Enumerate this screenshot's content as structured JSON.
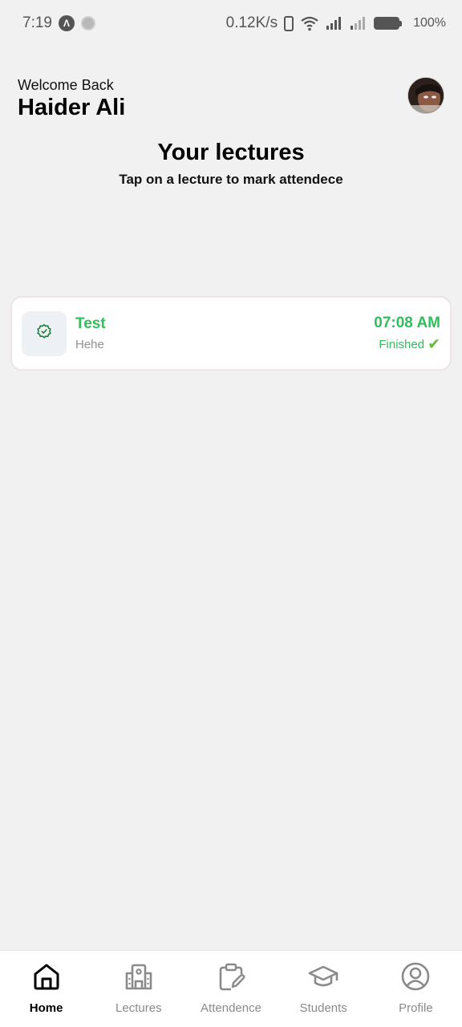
{
  "status_bar": {
    "time": "7:19",
    "network_speed": "0.12K/s",
    "battery": "100%"
  },
  "header": {
    "welcome": "Welcome Back",
    "user_name": "Haider Ali"
  },
  "section": {
    "title": "Your lectures",
    "subtitle": "Tap on a lecture to mark attendece"
  },
  "lectures": [
    {
      "title": "Test",
      "description": "Hehe",
      "time": "07:08 AM",
      "status": "Finished",
      "icon": "badge-check-icon"
    }
  ],
  "nav": {
    "items": [
      {
        "label": "Home",
        "icon": "home-icon",
        "active": true
      },
      {
        "label": "Lectures",
        "icon": "building-icon",
        "active": false
      },
      {
        "label": "Attendence",
        "icon": "clipboard-edit-icon",
        "active": false
      },
      {
        "label": "Students",
        "icon": "graduation-cap-icon",
        "active": false
      },
      {
        "label": "Profile",
        "icon": "user-circle-icon",
        "active": false
      }
    ]
  },
  "colors": {
    "accent_green": "#2fbf5a",
    "background": "#f1f1f2"
  }
}
